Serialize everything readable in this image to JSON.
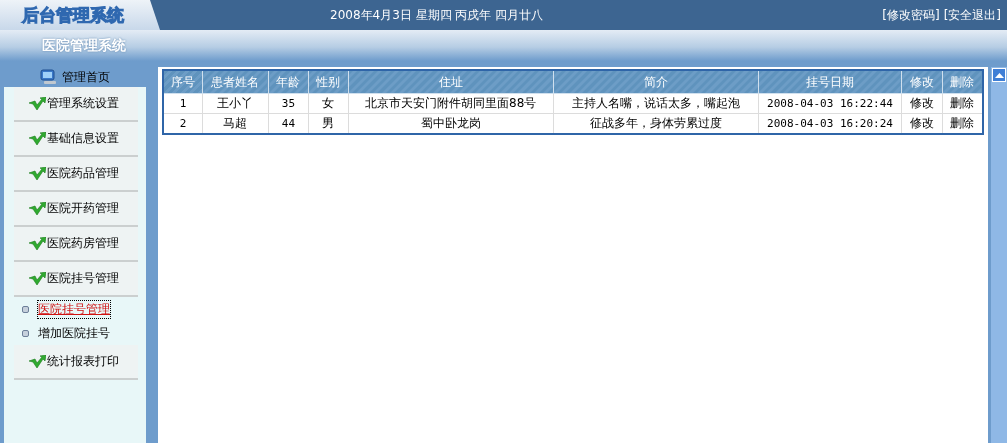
{
  "header": {
    "logo": "后台管理系统",
    "date": "2008年4月3日 星期四 丙戌年 四月廿八",
    "links": [
      "[修改密码]",
      "[安全退出]"
    ]
  },
  "subtitle": "医院管理系统",
  "sidebar": {
    "home": "管理首页",
    "items": [
      {
        "kind": "menu",
        "label": "管理系统设置"
      },
      {
        "kind": "menu",
        "label": "基础信息设置"
      },
      {
        "kind": "menu",
        "label": "医院药品管理"
      },
      {
        "kind": "menu",
        "label": "医院开药管理"
      },
      {
        "kind": "menu",
        "label": "医院药房管理"
      },
      {
        "kind": "menu",
        "label": "医院挂号管理"
      },
      {
        "kind": "link",
        "label": "医院挂号管理",
        "selected": true
      },
      {
        "kind": "link",
        "label": "增加医院挂号",
        "selected": false
      },
      {
        "kind": "menu",
        "label": "统计报表打印"
      }
    ]
  },
  "table": {
    "columns": [
      "序号",
      "患者姓名",
      "年龄",
      "性别",
      "住址",
      "简介",
      "挂号日期",
      "修改",
      "删除"
    ],
    "rows": [
      {
        "cells": [
          "1",
          "王小丫",
          "35",
          "女",
          "北京市天安门附件胡同里面88号",
          "主持人名嘴，说话太多，嘴起泡",
          "2008-04-03 16:22:44"
        ],
        "actions": [
          "修改",
          "删除"
        ]
      },
      {
        "cells": [
          "2",
          "马超",
          "44",
          "男",
          "蜀中卧龙岗",
          "征战多年，身体劳累过度",
          "2008-04-03 16:20:24"
        ],
        "actions": [
          "修改",
          "删除"
        ]
      }
    ]
  }
}
